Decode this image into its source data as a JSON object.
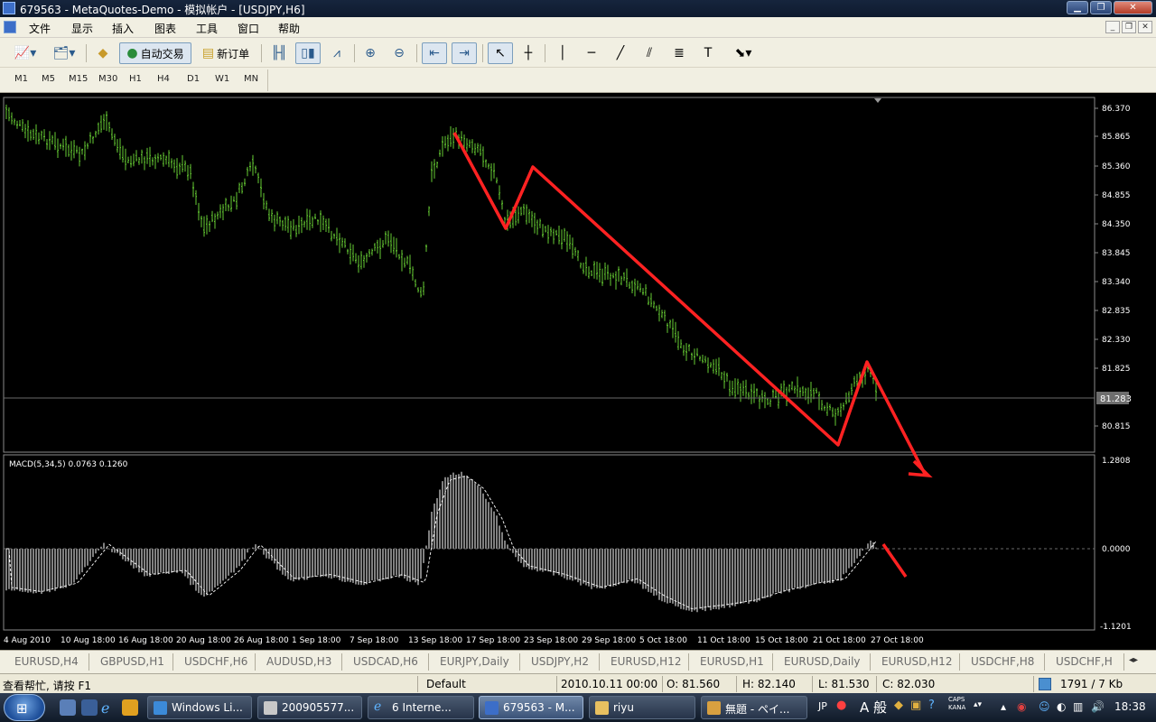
{
  "window": {
    "title": "679563 - MetaQuotes-Demo - 模拟帐户 - [USDJPY,H6]"
  },
  "menu": [
    "文件",
    "显示",
    "插入",
    "图表",
    "工具",
    "窗口",
    "帮助"
  ],
  "toolbar": {
    "auto_trade_label": "自动交易",
    "new_order_label": "新订单"
  },
  "periods": [
    "M1",
    "M5",
    "M15",
    "M30",
    "H1",
    "H4",
    "D1",
    "W1",
    "MN"
  ],
  "chart": {
    "symbol": "USDJPY",
    "timeframe": "H6",
    "price_ticks": [
      "86.370",
      "85.865",
      "85.360",
      "84.855",
      "84.350",
      "83.845",
      "83.340",
      "82.835",
      "82.330",
      "81.825",
      "80.815"
    ],
    "current_price": "81.283",
    "indicator_label": "MACD(5,34,5) 0.0763 0.1260",
    "macd_ticks": [
      "1.2808",
      "0.0000",
      "-1.1201"
    ],
    "time_ticks": [
      "4 Aug 2010",
      "10 Aug 18:00",
      "16 Aug 18:00",
      "20 Aug 18:00",
      "26 Aug 18:00",
      "1 Sep 18:00",
      "7 Sep 18:00",
      "13 Sep 18:00",
      "17 Sep 18:00",
      "23 Sep 18:00",
      "29 Sep 18:00",
      "5 Oct 18:00",
      "11 Oct 18:00",
      "15 Oct 18:00",
      "21 Oct 18:00",
      "27 Oct 18:00"
    ],
    "colors": {
      "background": "#000000",
      "bars": "#66cc33",
      "macd": "#ffffff",
      "annotation": "#ff2222",
      "grid_line": "#6a6a6a"
    }
  },
  "symbol_tabs": [
    "EURUSD,H4",
    "GBPUSD,H1",
    "USDCHF,H6",
    "AUDUSD,H3",
    "USDCAD,H6",
    "EURJPY,Daily",
    "USDJPY,H2",
    "EURUSD,H12",
    "EURUSD,H1",
    "EURUSD,Daily",
    "EURUSD,H12",
    "USDCHF,H8",
    "USDCHF,H"
  ],
  "status": {
    "help": "查看帮忙, 请按 F1",
    "profile": "Default",
    "datetime": "2010.10.11 00:00",
    "open": "O: 81.560",
    "high": "H: 82.140",
    "low": "L: 81.530",
    "close": "C: 82.030",
    "traffic": "1791 / 7 Kb"
  },
  "taskbar": {
    "buttons": [
      "Windows Li...",
      "200905577...",
      "6 Interne...",
      "679563 - M...",
      "riyu",
      "無題 - ペイ..."
    ],
    "lang": "JP",
    "ime_chars": "A 般",
    "caps_label": "CAPS",
    "kana_label": "KANA",
    "clock": "18:38"
  }
}
